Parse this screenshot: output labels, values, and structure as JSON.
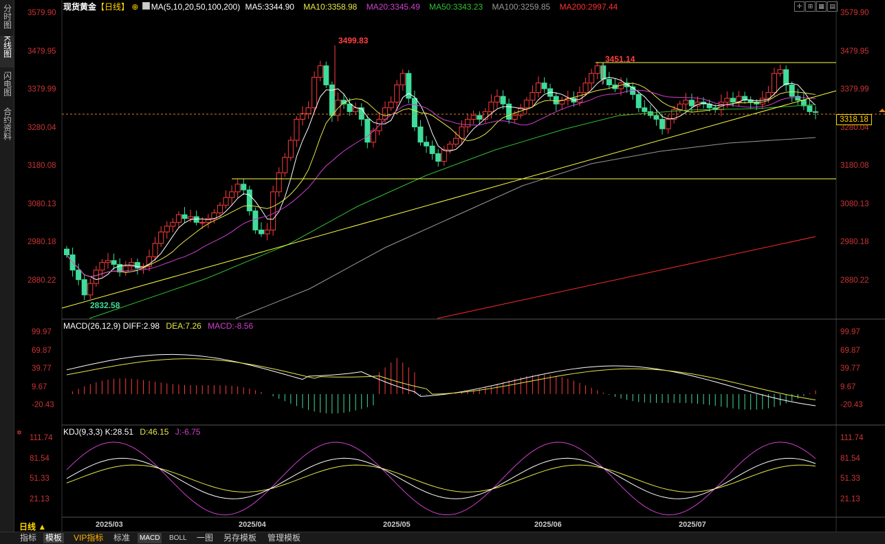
{
  "sidebar": {
    "tabs": [
      {
        "label": "分时图",
        "active": false
      },
      {
        "label": "K线图",
        "active": true
      },
      {
        "label": "闪电图",
        "active": false
      },
      {
        "label": "合约资料",
        "active": false
      }
    ]
  },
  "header": {
    "instrument": "现货黄金",
    "period_tag": "【日线】",
    "ma_params": "MA(5,10,20,50,100,200)",
    "ma5": "MA5:3344.90",
    "ma10": "MA10:3358.98",
    "ma20": "MA20:3345.49",
    "ma50": "MA50:3343.23",
    "ma100": "MA100:3259.85",
    "ma200": "MA200:2997.44"
  },
  "colors": {
    "up": "#ff3b3b",
    "down": "#3fdc9a",
    "ma5": "#ffffff",
    "ma10": "#e8e84a",
    "ma20": "#d040d0",
    "ma50": "#30c030",
    "ma100": "#9a9a9a",
    "ma200": "#ff2a2a",
    "trend": "#ffff40"
  },
  "price_axis": {
    "ticks": [
      "3579.90",
      "3479.95",
      "3379.99",
      "3280.04",
      "3180.08",
      "3080.13",
      "2980.18",
      "2880.22"
    ],
    "current": "3318.18"
  },
  "annotations": {
    "high1": "3499.83",
    "high2": "3451.14",
    "low": "2832.58"
  },
  "macd": {
    "title": "MACD(26,12,9)",
    "diff": "DIFF:2.98",
    "dea": "DEA:7.26",
    "macd": "MACD:-8.56",
    "ticks": [
      "99.97",
      "69.87",
      "39.77",
      "9.67",
      "-20.43"
    ]
  },
  "kdj": {
    "title": "KDJ(9,3,3)",
    "k": "K:28.51",
    "d": "D:46.15",
    "j": "J:-6.75",
    "ticks": [
      "111.74",
      "81.54",
      "51.33",
      "21.13"
    ]
  },
  "dates": [
    "2025/03",
    "2025/04",
    "2025/05",
    "2025/06",
    "2025/07"
  ],
  "period_label": "日线 ▲",
  "bottom_tabs": [
    {
      "label": "指标",
      "selected": false
    },
    {
      "label": "模板",
      "selected": true
    },
    {
      "label": "VIP指标",
      "selected": false
    },
    {
      "label": "标准",
      "selected": false
    },
    {
      "label": "MACD",
      "selected": true
    },
    {
      "label": "BOLL",
      "selected": false
    },
    {
      "label": "一图",
      "selected": false
    },
    {
      "label": "另存模板",
      "selected": false
    },
    {
      "label": "管理模板",
      "selected": false
    }
  ]
}
